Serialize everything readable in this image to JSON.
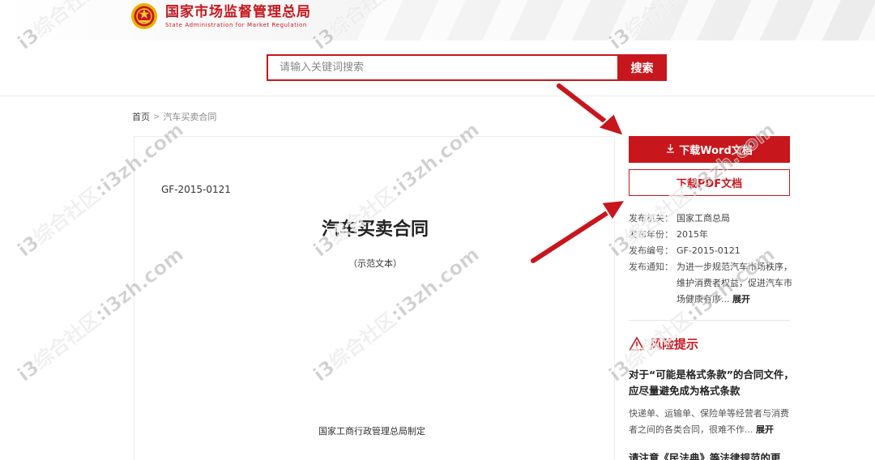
{
  "header": {
    "title_cn": "国家市场监督管理总局",
    "title_en": "State Administration for Market Regulation",
    "emblem_icon": "national-emblem-icon"
  },
  "search": {
    "placeholder": "请输入关键词搜索",
    "button_label": "搜索"
  },
  "breadcrumb": {
    "home": "首页",
    "separator": ">",
    "current": "汽车买卖合同"
  },
  "document": {
    "code": "GF-2015-0121",
    "title": "汽车买卖合同",
    "subtitle": "（示范文本）",
    "footer": "国家工商行政管理总局制定"
  },
  "sidebar": {
    "download_word": "下载Word文档",
    "download_pdf": "下载PDF文档",
    "download_icon": "download-arrow-icon",
    "meta": {
      "agency_label": "发布机关：",
      "agency_value": "国家工商总局",
      "year_label": "发布年份：",
      "year_value": "2015年",
      "code_label": "发布编号：",
      "code_value": "GF-2015-0121",
      "notice_label": "发布通知：",
      "notice_value": "为进一步规范汽车市场秩序，维护消费者权益，促进汽车市场健康有序...",
      "notice_expand": "展开"
    },
    "risk": {
      "icon": "warning-icon",
      "title": "风险提示",
      "q1": "对于“可能是格式条款”的合同文件，应尽量避免成为格式条款",
      "a1": "快递单、运输单、保险单等经营者与消费者之间的各类合同，很难不作...",
      "a1_expand": "展开",
      "q2": "请注意《民法典》等法律规范的更"
    }
  },
  "watermark": {
    "text": "i3综合社区:i3zh.com"
  },
  "colors": {
    "brand_red": "#c8161d",
    "text_dark": "#222222",
    "text_gray": "#555555",
    "border": "#ececec"
  }
}
